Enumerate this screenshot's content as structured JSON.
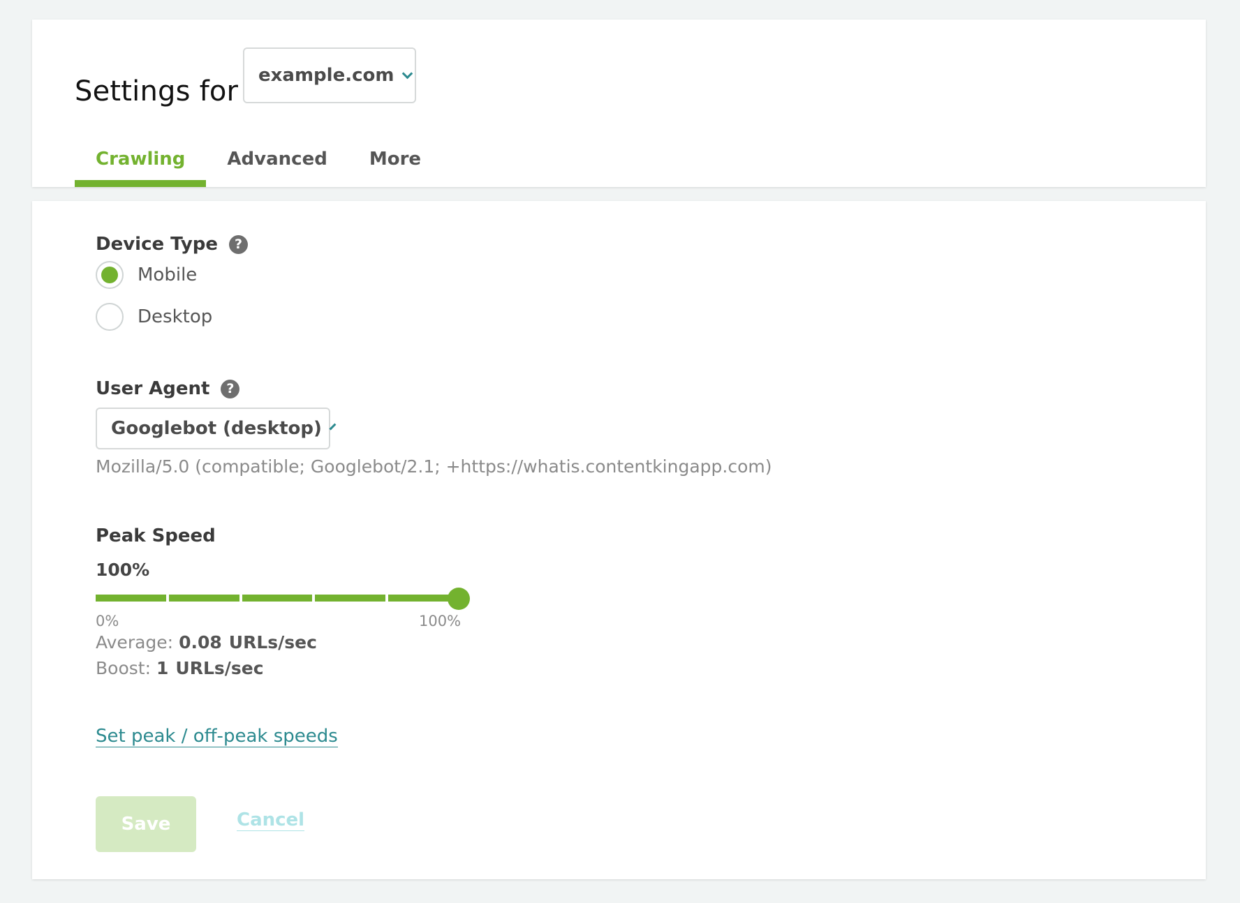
{
  "header": {
    "title": "Settings for",
    "website_select": {
      "value": "example.com"
    },
    "tabs": [
      {
        "label": "Crawling",
        "active": true
      },
      {
        "label": "Advanced",
        "active": false
      },
      {
        "label": "More",
        "active": false
      }
    ]
  },
  "device_type": {
    "label": "Device Type",
    "help_icon": "?",
    "options": [
      {
        "label": "Mobile",
        "selected": true
      },
      {
        "label": "Desktop",
        "selected": false
      }
    ]
  },
  "user_agent": {
    "label": "User Agent",
    "help_icon": "?",
    "selected": "Googlebot (desktop)",
    "string": "Mozilla/5.0 (compatible; Googlebot/2.1; +https://whatis.contentkingapp.com)"
  },
  "peak_speed": {
    "label": "Peak Speed",
    "value_text": "100%",
    "value": 1.0,
    "min_label": "0%",
    "max_label": "100%",
    "average_label": "Average:",
    "average_value": "0.08",
    "average_unit": "URLs/sec",
    "boost_label": "Boost:",
    "boost_value": "1",
    "boost_unit": "URLs/sec"
  },
  "links": {
    "set_speeds": "Set peak / off-peak speeds"
  },
  "actions": {
    "save_label": "Save",
    "cancel_label": "Cancel"
  },
  "colors": {
    "accent_green": "#73b22f",
    "link_teal": "#2c8a8f",
    "background": "#f1f4f4"
  }
}
